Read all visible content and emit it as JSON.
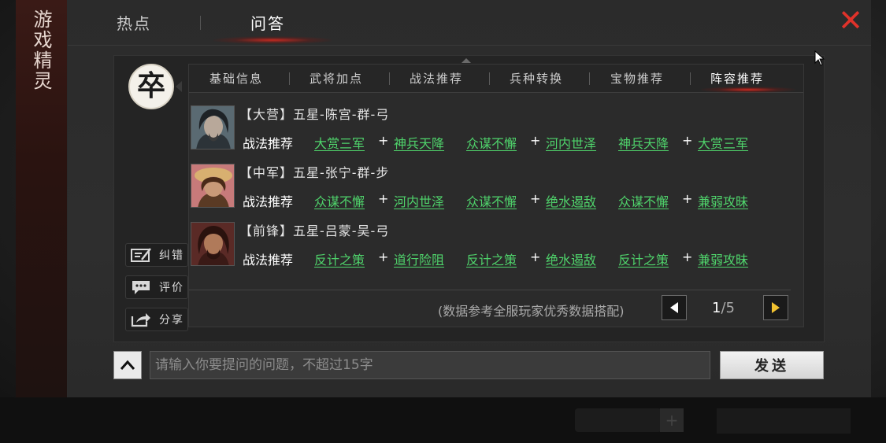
{
  "side_title": "游戏精灵",
  "top_tabs": [
    {
      "label": "热点",
      "active": false
    },
    {
      "label": "问答",
      "active": true
    }
  ],
  "avatar_char": "卒",
  "side_buttons": [
    {
      "label": "纠错",
      "icon": "edit-icon"
    },
    {
      "label": "评价",
      "icon": "comment-icon"
    },
    {
      "label": "分享",
      "icon": "share-icon"
    }
  ],
  "sub_tabs": [
    {
      "label": "基础信息",
      "active": false
    },
    {
      "label": "武将加点",
      "active": false
    },
    {
      "label": "战法推荐",
      "active": false
    },
    {
      "label": "兵种转换",
      "active": false
    },
    {
      "label": "宝物推荐",
      "active": false
    },
    {
      "label": "阵容推荐",
      "active": true
    }
  ],
  "lineup": [
    {
      "title": "【大营】五星-陈宫-群-弓",
      "label": "战法推荐",
      "skills": [
        "大赏三军",
        "神兵天降",
        "众谋不懈",
        "河内世泽",
        "神兵天降",
        "大赏三军"
      ]
    },
    {
      "title": "【中军】五星-张宁-群-步",
      "label": "战法推荐",
      "skills": [
        "众谋不懈",
        "河内世泽",
        "众谋不懈",
        "绝水遏敌",
        "众谋不懈",
        "兼弱攻昧"
      ]
    },
    {
      "title": "【前锋】五星-吕蒙-吴-弓",
      "label": "战法推荐",
      "skills": [
        "反计之策",
        "道行险阻",
        "反计之策",
        "绝水遏敌",
        "反计之策",
        "兼弱攻昧"
      ]
    }
  ],
  "plus": "+",
  "note": "(数据参考全服玩家优秀数据搭配)",
  "pager": {
    "current": "1",
    "total": "5",
    "sep": "/"
  },
  "input": {
    "placeholder": "请输入你要提问的问题，不超过15字",
    "value": ""
  },
  "send_label": "发送",
  "colors": {
    "skill": "#4fd36b",
    "close": "#e0322a",
    "active_glow": "#dc281e"
  }
}
